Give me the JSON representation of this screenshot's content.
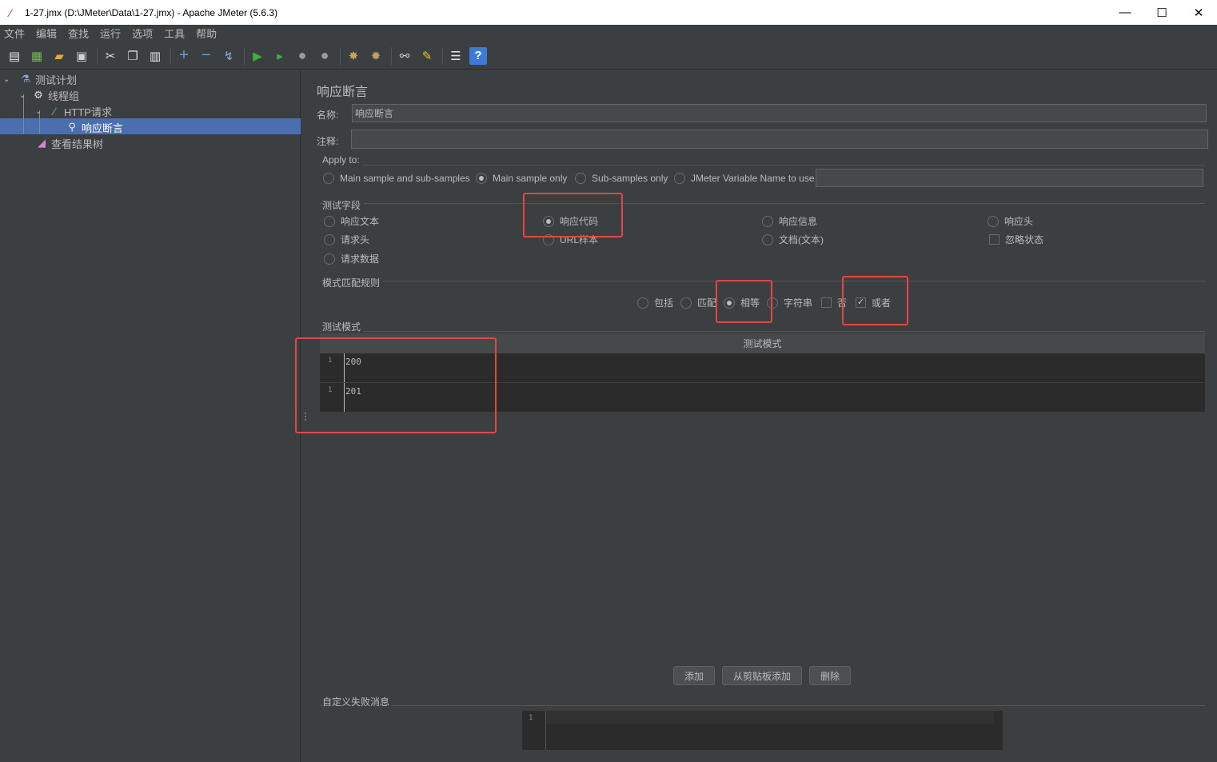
{
  "window": {
    "title": "1-27.jmx (D:\\JMeter\\Data\\1-27.jmx) - Apache JMeter (5.6.3)",
    "minimize": "—",
    "maximize": "☐",
    "close": "✕"
  },
  "menu": [
    "文件",
    "编辑",
    "查找",
    "运行",
    "选项",
    "工具",
    "帮助"
  ],
  "toolbar_icons": [
    "new-icon",
    "templates-icon",
    "open-icon",
    "save-icon",
    "cut-icon",
    "copy-icon",
    "paste-icon",
    "expand-icon",
    "collapse-icon",
    "toggle-icon",
    "start-icon",
    "start-no-pause-icon",
    "stop-icon",
    "shutdown-icon",
    "clear-icon",
    "clear-all-icon",
    "search-icon",
    "reset-search-icon",
    "function-helper-icon",
    "help-icon"
  ],
  "tree": {
    "test_plan": "测试计划",
    "thread_group": "线程组",
    "http_request": "HTTP请求",
    "response_assertion": "响应断言",
    "view_results_tree": "查看结果树"
  },
  "panel": {
    "title": "响应断言",
    "name_label": "名称:",
    "name_value": "响应断言",
    "comment_label": "注释:",
    "comment_value": ""
  },
  "apply_to": {
    "title": "Apply to:",
    "options": [
      "Main sample and sub-samples",
      "Main sample only",
      "Sub-samples only",
      "JMeter Variable Name to use"
    ],
    "selected": "Main sample only",
    "variable_value": ""
  },
  "field_to_test": {
    "title": "测试字段",
    "response_text": "响应文本",
    "response_code": "响应代码",
    "response_message": "响应信息",
    "response_headers": "响应头",
    "request_headers": "请求头",
    "url_sampled": "URL样本",
    "document_text": "文档(文本)",
    "ignore_status": "忽略状态",
    "request_data": "请求数据",
    "selected": "响应代码"
  },
  "pattern_matching": {
    "title": "模式匹配规则",
    "contains": "包括",
    "matches": "匹配",
    "equals": "相等",
    "substring": "字符串",
    "not": "否",
    "or": "或者",
    "selected": "相等",
    "or_checked": true
  },
  "patterns": {
    "title": "测试模式",
    "column": "测试模式",
    "rows": [
      {
        "line": "1",
        "value": "200"
      },
      {
        "line": "1",
        "value": "201"
      }
    ]
  },
  "buttons": {
    "add": "添加",
    "add_clipboard": "从剪贴板添加",
    "delete": "删除"
  },
  "failure": {
    "title": "自定义失败消息",
    "line": "1",
    "value": ""
  },
  "colors": {
    "background": "#3c3f41",
    "selection": "#4b6eaf",
    "highlight": "#e04848"
  }
}
